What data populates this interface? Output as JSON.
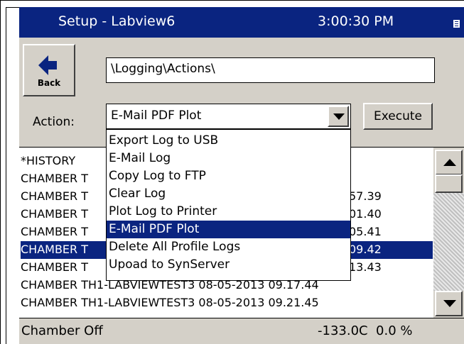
{
  "window": {
    "title": "Setup - Labview6",
    "time": "3:00:30 PM"
  },
  "back_button": {
    "label": "Back"
  },
  "path": {
    "value": "\\Logging\\Actions\\"
  },
  "action": {
    "label": "Action:",
    "selected": "E-Mail PDF Plot",
    "options": [
      "Export Log to USB",
      "E-Mail Log",
      "Copy Log to FTP",
      "Clear Log",
      "Plot Log to Printer",
      "E-Mail PDF Plot",
      "Delete All Profile Logs",
      "Upoad to SynServer"
    ],
    "highlighted_option": "E-Mail PDF Plot"
  },
  "execute_button": {
    "label": "Execute"
  },
  "log_list": {
    "items": [
      {
        "left": "*HISTORY",
        "right": ""
      },
      {
        "left": "CHAMBER T",
        "right": ""
      },
      {
        "left": "CHAMBER T",
        "right": "57.39"
      },
      {
        "left": "CHAMBER T",
        "right": "01.40"
      },
      {
        "left": "CHAMBER T",
        "right": "05.41"
      },
      {
        "left": "CHAMBER T",
        "right": "09.42"
      },
      {
        "left": "CHAMBER T",
        "right": "13.43"
      },
      {
        "left": "CHAMBER TH1-LABVIEWTEST3 08-05-2013 09.17.44",
        "right": ""
      },
      {
        "left": "CHAMBER TH1-LABVIEWTEST3 08-05-2013 09.21.45",
        "right": ""
      }
    ],
    "selected_index": 5
  },
  "status": {
    "chamber": "Chamber Off",
    "readout": "-133.0C  0.0 %"
  },
  "colors": {
    "titlebar": "#0a2480",
    "selection": "#0a2480",
    "panel": "#d4d0c8"
  }
}
